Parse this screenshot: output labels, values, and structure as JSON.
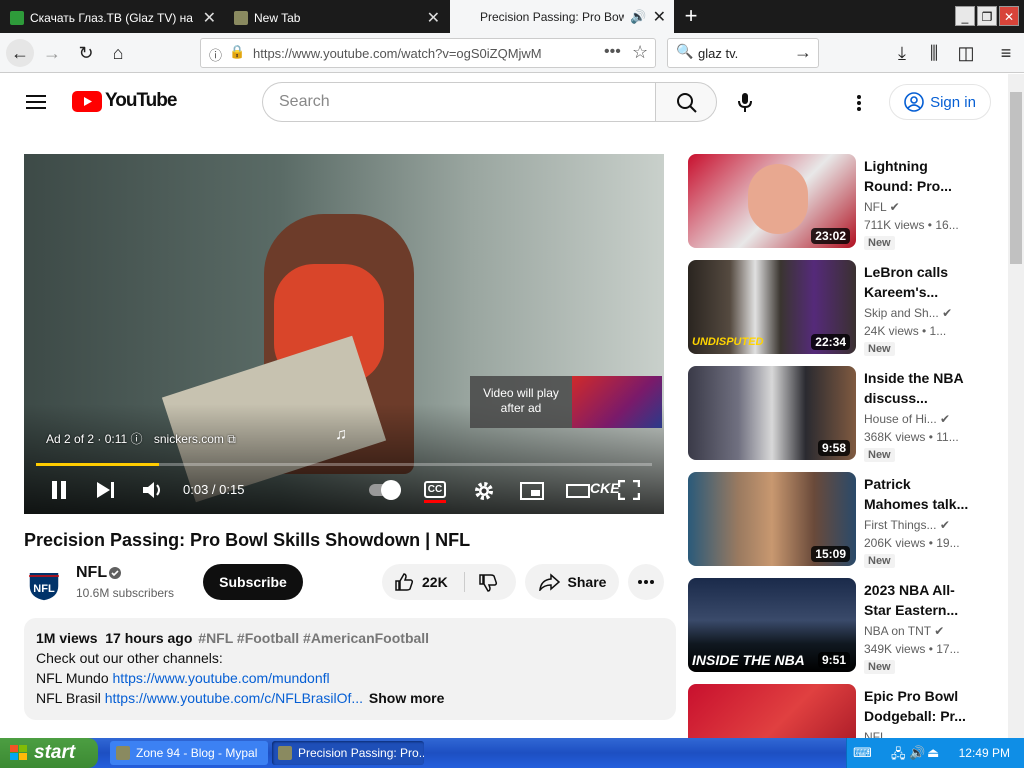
{
  "browser": {
    "tabs": [
      {
        "title": "Скачать Глаз.ТВ (Glaz TV) на ру",
        "active": false
      },
      {
        "title": "New Tab",
        "active": false
      },
      {
        "title": "Precision Passing: Pro Bowl Ski",
        "active": true
      }
    ],
    "new_tab_symbol": "+",
    "url": "https://www.youtube.com/watch?v=ogS0iZQMjwM",
    "search_query": "glaz tv."
  },
  "youtube": {
    "logo_text": "YouTube",
    "search_placeholder": "Search",
    "signin_label": "Sign in",
    "player": {
      "ad_label": "Ad 2 of 2 · 0:11",
      "ad_site": "snickers.com",
      "time": "0:03 / 0:15",
      "progress": 0.2,
      "video_will_play": "Video will play after ad",
      "cc_label": "CC",
      "watermark": "CKE"
    },
    "video": {
      "title": "Precision Passing: Pro Bowl Skills Showdown | NFL",
      "channel": "NFL",
      "subscribers": "10.6M subscribers",
      "subscribe_label": "Subscribe",
      "likes": "22K",
      "share_label": "Share"
    },
    "description": {
      "stats": "1M views  17 hours ago",
      "hashtags": "#NFL #Football #AmericanFootball",
      "line1": "Check out our other channels:",
      "line2_prefix": "NFL Mundo ",
      "line2_link": "https://www.youtube.com/mundonfl",
      "line3_prefix": "NFL Brasil ",
      "line3_link": "https://www.youtube.com/c/NFLBrasilOf...",
      "show_more": "Show more"
    },
    "recommendations": [
      {
        "title": "Lightning Round: Pro...",
        "channel": "NFL",
        "meta": "711K views  • 16...",
        "duration": "23:02",
        "badge": "New",
        "overlay": ""
      },
      {
        "title": "LeBron calls Kareem's...",
        "channel": "Skip and Sh...",
        "meta": "24K views  • 1...",
        "duration": "22:34",
        "badge": "New",
        "overlay": "UNDISPUTED"
      },
      {
        "title": "Inside the NBA discuss...",
        "channel": "House of Hi...",
        "meta": "368K views  • 11...",
        "duration": "9:58",
        "badge": "New",
        "overlay": ""
      },
      {
        "title": "Patrick Mahomes talk...",
        "channel": "First Things...",
        "meta": "206K views  • 19...",
        "duration": "15:09",
        "badge": "New",
        "overlay": ""
      },
      {
        "title": "2023 NBA All-Star Eastern...",
        "channel": "NBA on TNT",
        "meta": "349K views  • 17...",
        "duration": "9:51",
        "badge": "New",
        "overlay": "INSIDE THE NBA"
      },
      {
        "title": "Epic Pro Bowl Dodgeball: Pr...",
        "channel": "NFL",
        "meta": "",
        "duration": "",
        "badge": "",
        "overlay": ""
      }
    ]
  },
  "taskbar": {
    "start_label": "start",
    "tasks": [
      {
        "title": "Zone 94 - Blog - Mypal",
        "active": false
      },
      {
        "title": "Precision Passing: Pro...",
        "active": true
      }
    ],
    "clock": "12:49 PM"
  },
  "colors": {
    "yt_red": "#ff0000",
    "link_blue": "#065fd4",
    "tab_dark": "#1b1b1b",
    "xp_blue": "#245edc",
    "xp_green": "#3c8a33"
  }
}
